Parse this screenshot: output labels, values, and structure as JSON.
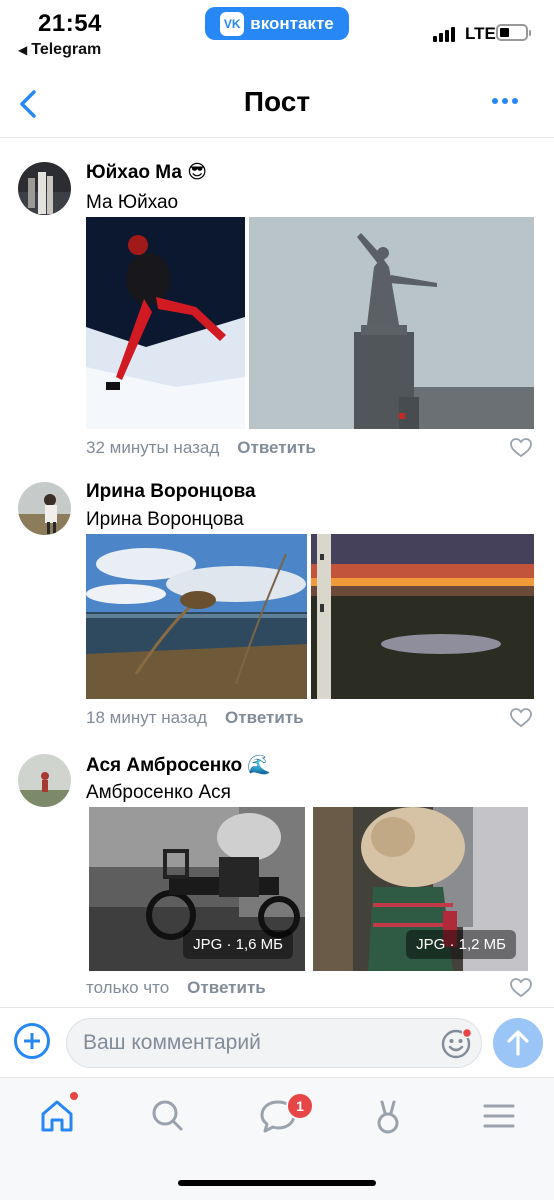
{
  "status_bar": {
    "time": "21:54",
    "back_app": "Telegram",
    "center_app": "вконтакте",
    "network": "LTE"
  },
  "nav": {
    "title": "Пост"
  },
  "comments": [
    {
      "author": "Юйхао Ма 😎",
      "text": "Ма Юйхао",
      "time": "32 минуты назад",
      "reply": "Ответить",
      "photos": [
        {
          "icon": "photo-snow-figure"
        },
        {
          "icon": "photo-monument"
        }
      ]
    },
    {
      "author": "Ирина Воронцова",
      "text": "Ирина Воронцова",
      "time": "18 минут назад",
      "reply": "Ответить",
      "photos": [
        {
          "icon": "photo-seashore"
        },
        {
          "icon": "photo-sunset"
        }
      ]
    },
    {
      "author": "Ася Амбросенко 🌊",
      "text": "Амбросенко Ася",
      "time": "только что",
      "reply": "Ответить",
      "photos": [
        {
          "icon": "photo-scooter",
          "badge": "JPG · 1,6 МБ"
        },
        {
          "icon": "photo-fur-coat",
          "badge": "JPG · 1,2 МБ"
        }
      ]
    }
  ],
  "composer": {
    "placeholder": "Ваш комментарий"
  },
  "tabbar": {
    "messages_badge": "1"
  },
  "colors": {
    "accent": "#2787f5",
    "secondary_text": "#818c99",
    "badge_red": "#e64646"
  }
}
